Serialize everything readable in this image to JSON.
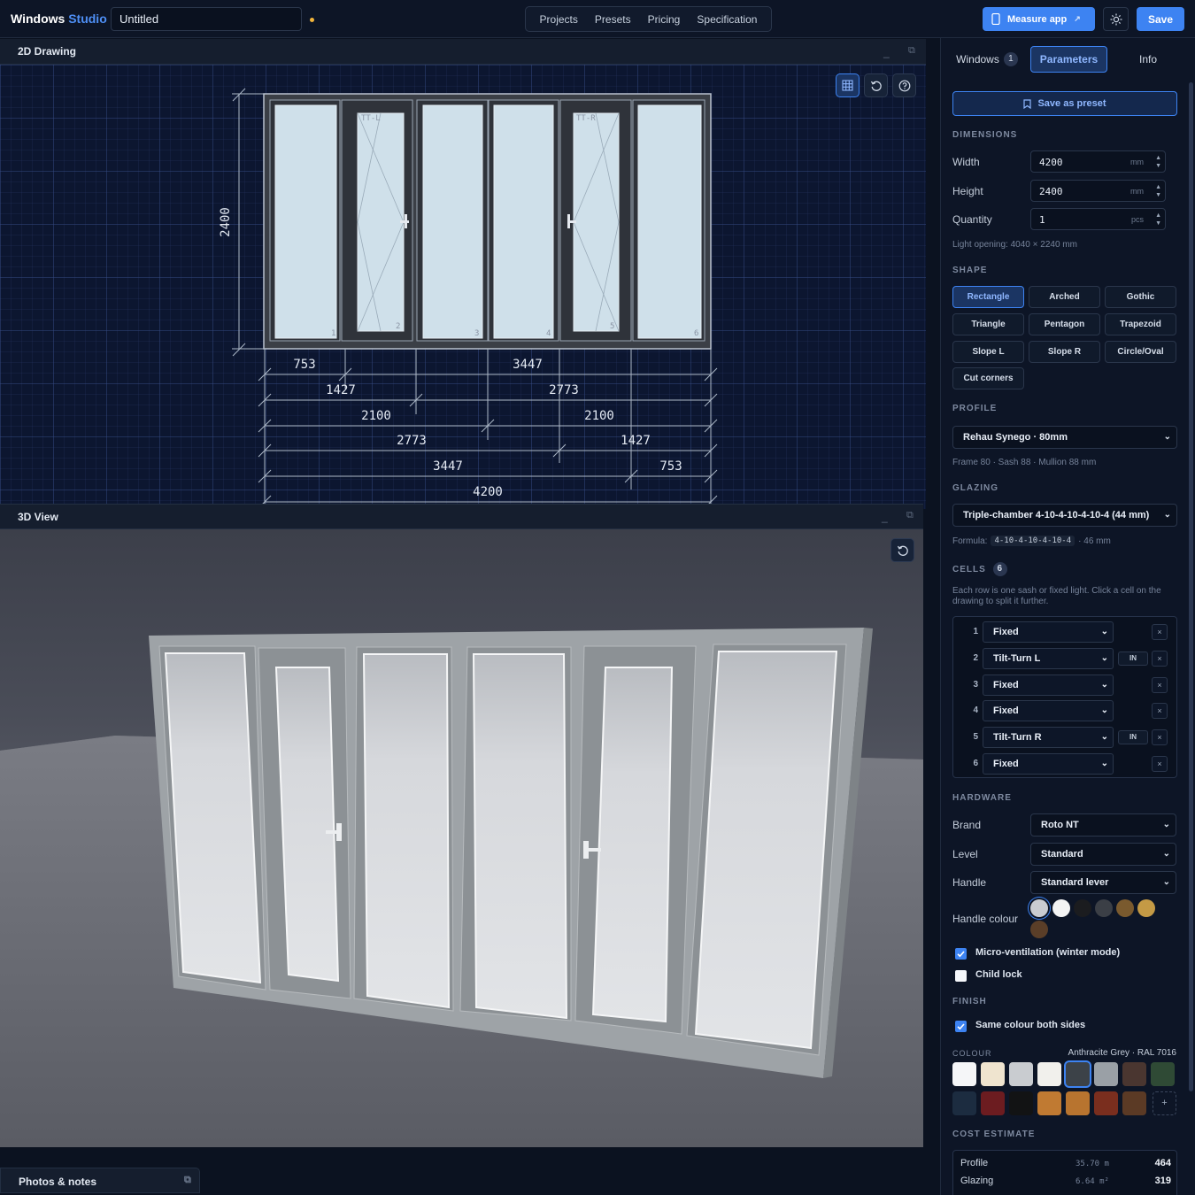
{
  "topbar": {
    "brand_main": "Windows",
    "brand_accent": "Studio",
    "project_name": "Untitled",
    "nav": [
      "Projects",
      "Presets",
      "Pricing",
      "Specification"
    ],
    "measure_label": "Measure app",
    "save_label": "Save"
  },
  "drawing_panel": {
    "title": "2D Drawing",
    "height_dim": "2400",
    "cell_tags": [
      "TT-L",
      "TT-R"
    ],
    "cell_numbers": [
      "1",
      "2",
      "3",
      "4",
      "5",
      "6"
    ],
    "dims": [
      "753",
      "3447",
      "1427",
      "2773",
      "2100",
      "2100",
      "2773",
      "1427",
      "3447",
      "753",
      "4200"
    ]
  },
  "view3d_panel": {
    "title": "3D View"
  },
  "photos_panel": {
    "title": "Photos & notes"
  },
  "sidebar": {
    "tabs": [
      {
        "label": "Windows",
        "badge": "1"
      },
      {
        "label": "Parameters"
      },
      {
        "label": "Info"
      }
    ],
    "save_preset_label": "Save as preset",
    "dimensions": {
      "heading": "DIMENSIONS",
      "width_label": "Width",
      "width_value": "4200",
      "width_unit": "mm",
      "height_label": "Height",
      "height_value": "2400",
      "height_unit": "mm",
      "quantity_label": "Quantity",
      "quantity_value": "1",
      "quantity_unit": "pcs",
      "light_opening": "Light opening: 4040 × 2240 mm"
    },
    "shape": {
      "heading": "SHAPE",
      "options": [
        "Rectangle",
        "Arched",
        "Gothic",
        "Triangle",
        "Pentagon",
        "Trapezoid",
        "Slope L",
        "Slope R",
        "Circle/Oval",
        "Cut corners"
      ],
      "selected": "Rectangle"
    },
    "profile": {
      "heading": "PROFILE",
      "selected": "Rehau Synego · 80mm",
      "note": "Frame 80 · Sash 88 · Mullion 88 mm"
    },
    "glazing": {
      "heading": "GLAZING",
      "selected": "Triple-chamber 4-10-4-10-4-10-4 (44 mm)",
      "formula_label": "Formula:",
      "formula_code": "4-10-4-10-4-10-4",
      "formula_suffix": "· 46 mm"
    },
    "cells": {
      "heading": "CELLS",
      "count": "6",
      "help": "Each row is one sash or fixed light. Click a cell on the drawing to split it further.",
      "rows": [
        {
          "n": "1",
          "type": "Fixed",
          "dir": ""
        },
        {
          "n": "2",
          "type": "Tilt-Turn L",
          "dir": "IN"
        },
        {
          "n": "3",
          "type": "Fixed",
          "dir": ""
        },
        {
          "n": "4",
          "type": "Fixed",
          "dir": ""
        },
        {
          "n": "5",
          "type": "Tilt-Turn R",
          "dir": "IN"
        },
        {
          "n": "6",
          "type": "Fixed",
          "dir": ""
        }
      ]
    },
    "hardware": {
      "heading": "HARDWARE",
      "brand_label": "Brand",
      "brand_value": "Roto NT",
      "level_label": "Level",
      "level_value": "Standard",
      "handle_label": "Handle",
      "handle_value": "Standard lever",
      "handle_colour_label": "Handle colour",
      "handle_colours": [
        "#c9ccd1",
        "#f4f4f4",
        "#1b1c1f",
        "#3b3f46",
        "#7a5a2e",
        "#c49a45",
        "#5a3e28"
      ],
      "micro_vent_label": "Micro-ventilation (winter mode)",
      "micro_vent_checked": true,
      "child_lock_label": "Child lock",
      "child_lock_checked": false
    },
    "finish": {
      "heading": "FINISH",
      "same_colour_label": "Same colour both sides",
      "same_colour_checked": true,
      "colour_heading": "COLOUR",
      "colour_selected": "Anthracite Grey · RAL 7016",
      "colours": [
        "#f5f6f8",
        "#efe4cf",
        "#c9ccd0",
        "#f1f0ec",
        "#3c4248",
        "#9aa0a6",
        "#4a3630",
        "#2f4a35",
        "#1c2c40",
        "#6c1c20",
        "#121314",
        "#c07a32",
        "#b8742f",
        "#7a2e1e",
        "#5b3a25"
      ],
      "add_label": "+"
    },
    "cost": {
      "heading": "COST ESTIMATE",
      "rows": [
        {
          "label": "Profile",
          "qty": "35.70 m",
          "price": "464"
        },
        {
          "label": "Glazing",
          "qty": "6.64 m²",
          "price": "319"
        }
      ]
    }
  }
}
